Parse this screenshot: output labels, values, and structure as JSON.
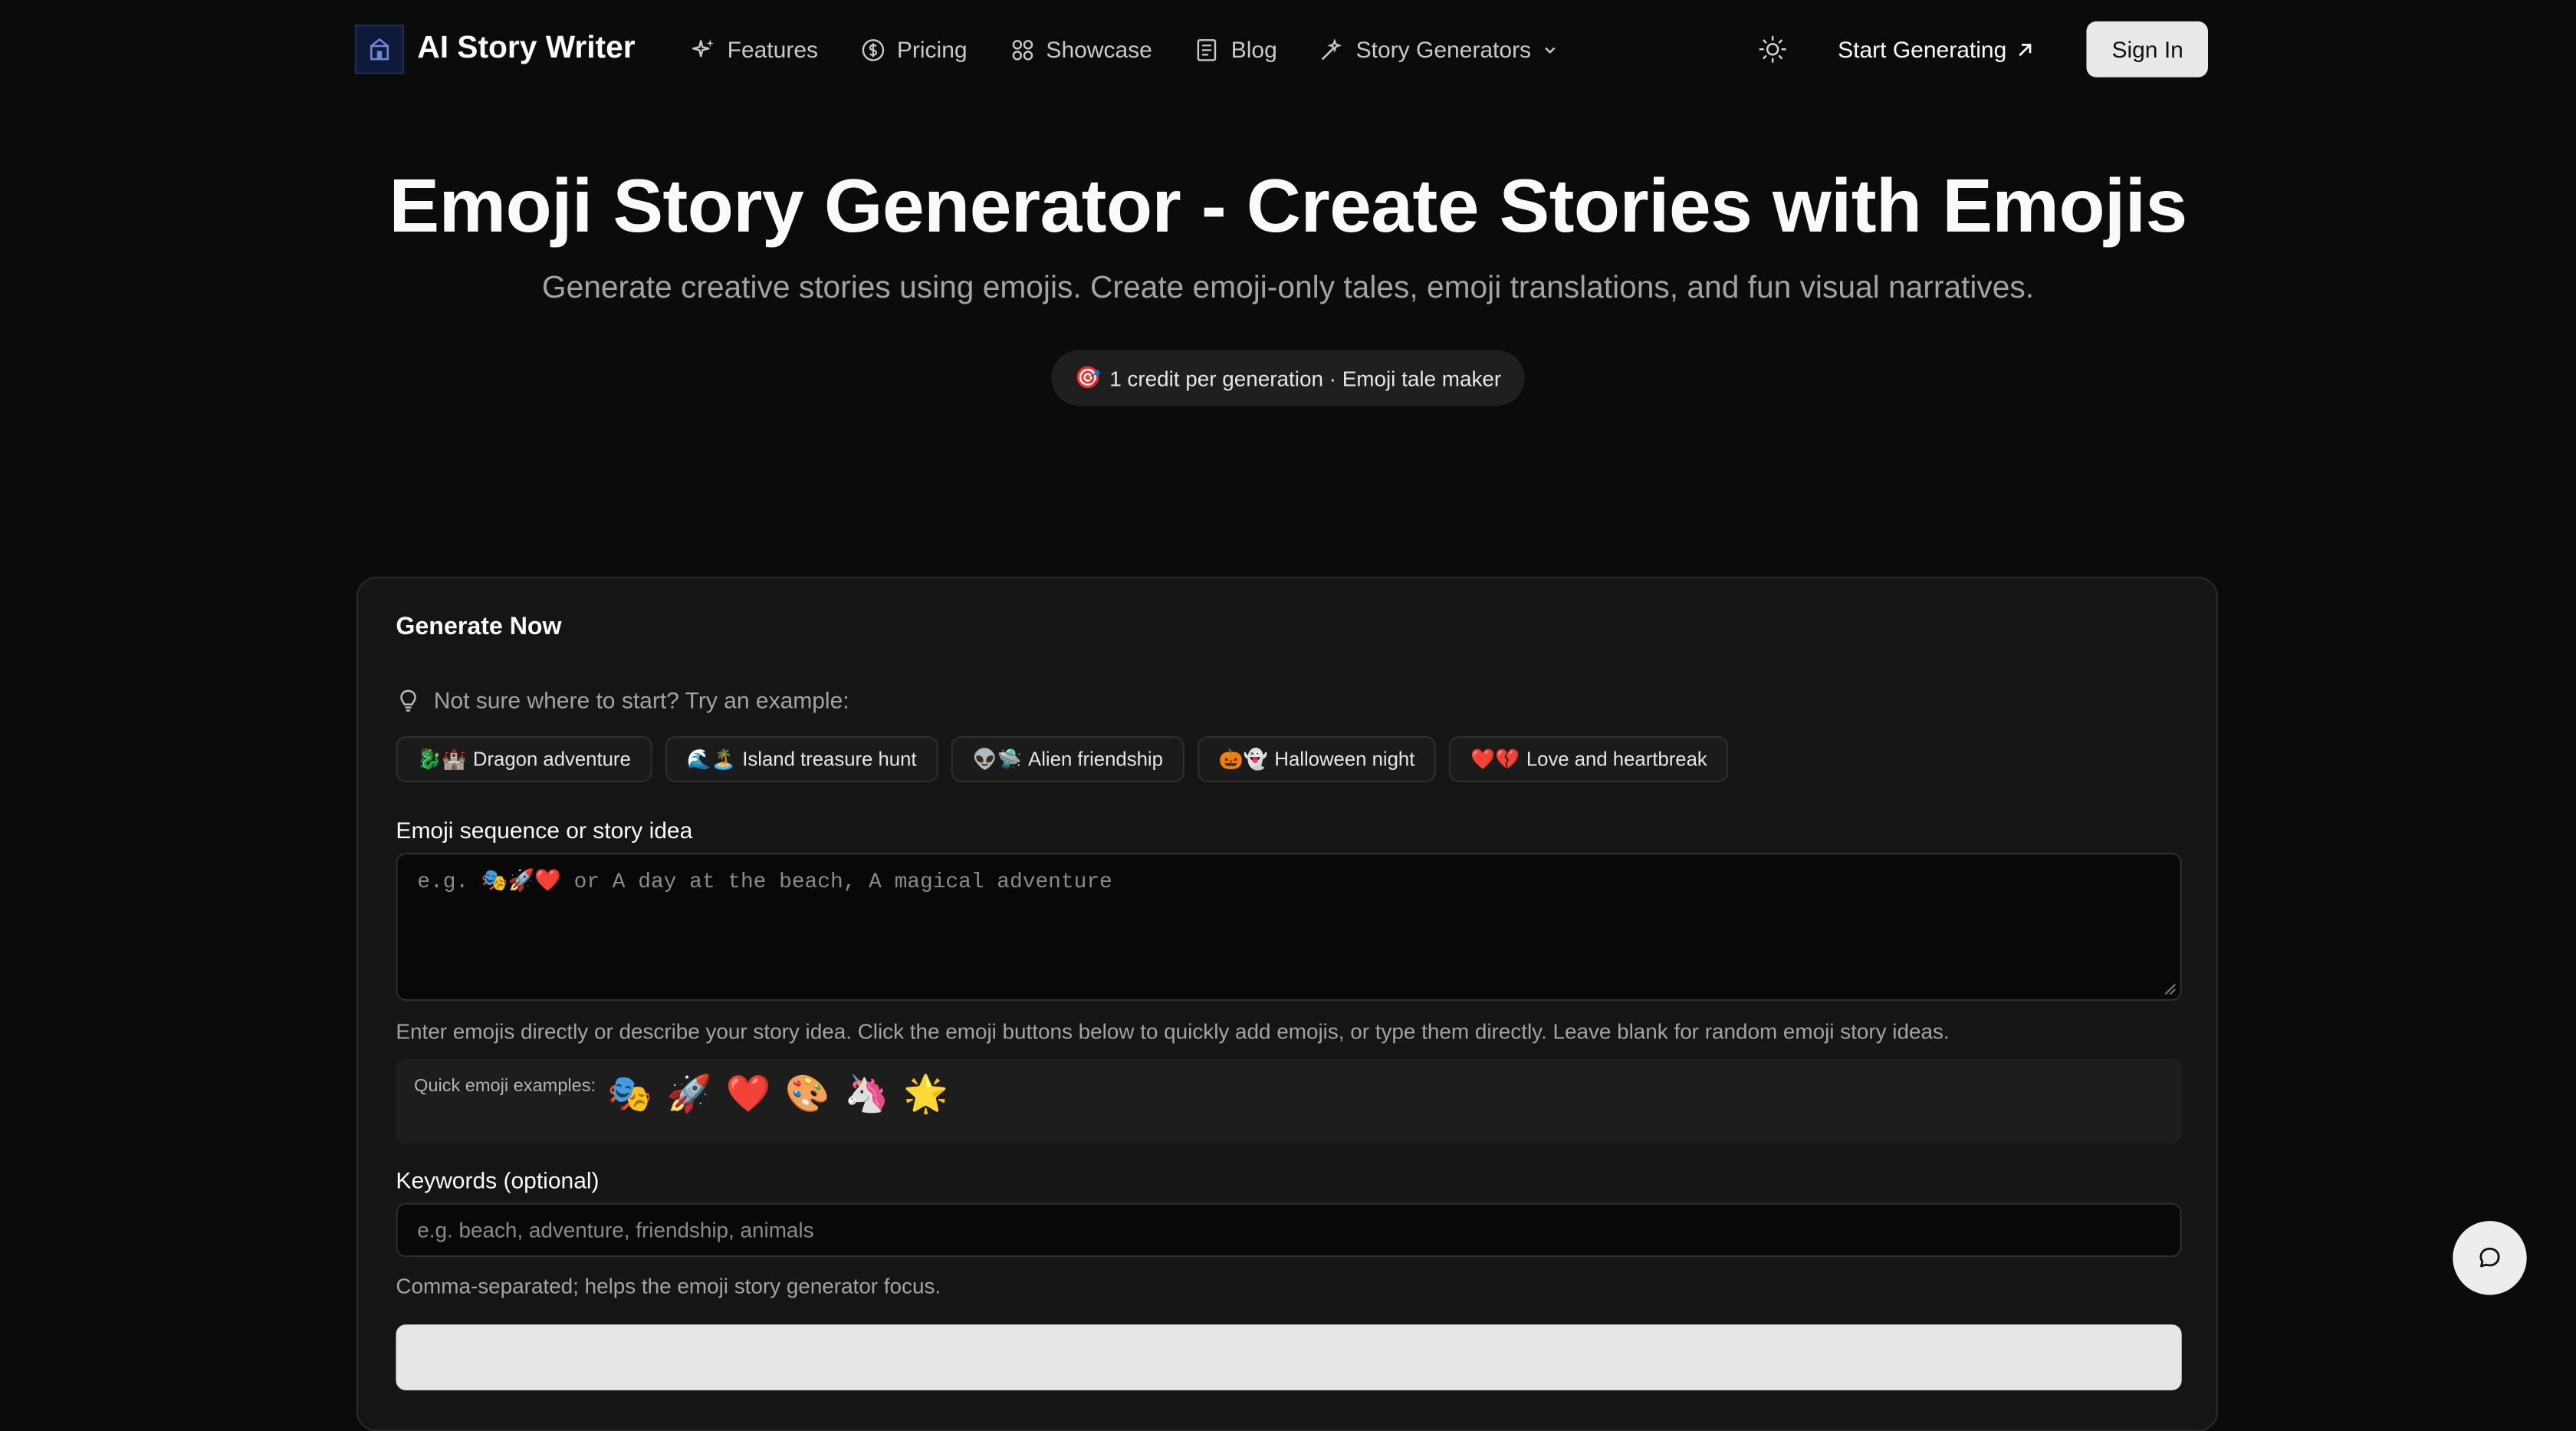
{
  "nav": {
    "brand": "AI Story Writer",
    "links": [
      {
        "label": "Features",
        "icon": "sparkles-icon"
      },
      {
        "label": "Pricing",
        "icon": "dollar-circle-icon"
      },
      {
        "label": "Showcase",
        "icon": "grid-icon"
      },
      {
        "label": "Blog",
        "icon": "document-icon"
      },
      {
        "label": "Story Generators",
        "icon": "wand-icon",
        "dropdown": true
      }
    ],
    "start_label": "Start Generating",
    "signin_label": "Sign In"
  },
  "hero": {
    "title": "Emoji Story Generator - Create Stories with Emojis",
    "subtitle": "Generate creative stories using emojis. Create emoji-only tales, emoji translations, and fun visual narratives.",
    "pill_emoji": "🎯",
    "pill_text": "1 credit per generation · Emoji tale maker"
  },
  "card": {
    "title": "Generate Now",
    "hint": "Not sure where to start? Try an example:",
    "examples": [
      {
        "emoji": "🐉🏰",
        "label": "Dragon adventure"
      },
      {
        "emoji": "🌊🏝️",
        "label": "Island treasure hunt"
      },
      {
        "emoji": "👽🛸",
        "label": "Alien friendship"
      },
      {
        "emoji": "🎃👻",
        "label": "Halloween night"
      },
      {
        "emoji": "❤️💔",
        "label": "Love and heartbreak"
      }
    ],
    "sequence_label": "Emoji sequence or story idea",
    "sequence_placeholder": "e.g. 🎭🚀❤️ or A day at the beach, A magical adventure",
    "sequence_help": "Enter emojis directly or describe your story idea. Click the emoji buttons below to quickly add emojis, or type them directly. Leave blank for random emoji story ideas.",
    "quick_label": "Quick emoji examples:",
    "quick_emojis": [
      "🎭",
      "🚀",
      "❤️",
      "🎨",
      "🦄",
      "🌟"
    ],
    "keywords_label": "Keywords (optional)",
    "keywords_placeholder": "e.g. beach, adventure, friendship, animals",
    "keywords_help": "Comma-separated; helps the emoji story generator focus."
  },
  "colors": {
    "background": "#0b0b0b",
    "card": "#151515",
    "button_light": "#e6e6e6",
    "muted_text": "#a3a3a3"
  }
}
